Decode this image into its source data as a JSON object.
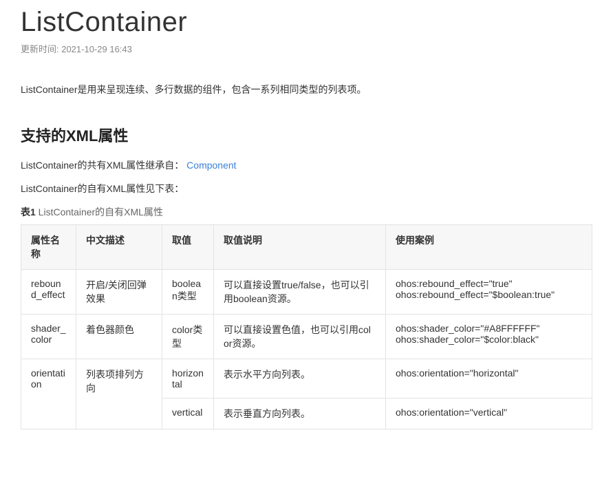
{
  "title": "ListContainer",
  "update_label": "更新时间: 2021-10-29 16:43",
  "intro": "ListContainer是用来呈现连续、多行数据的组件，包含一系列相同类型的列表项。",
  "section_title": "支持的XML属性",
  "inherit_prefix": "ListContainer的共有XML属性继承自：",
  "inherit_link": "Component",
  "own_attrs_text": "ListContainer的自有XML属性见下表：",
  "caption_bold": "表1",
  "caption_rest": " ListContainer的自有XML属性",
  "headers": {
    "h1": "属性名称",
    "h2": "中文描述",
    "h3": "取值",
    "h4": "取值说明",
    "h5": "使用案例"
  },
  "rows": {
    "r1": {
      "name": "rebound_effect",
      "desc": "开启/关闭回弹效果",
      "value": "boolean类型",
      "note": "可以直接设置true/false，也可以引用boolean资源。",
      "example": "ohos:rebound_effect=\"true\"\nohos:rebound_effect=\"$boolean:true\""
    },
    "r2": {
      "name": "shader_color",
      "desc": "着色器颜色",
      "value": "color类型",
      "note": "可以直接设置色值，也可以引用color资源。",
      "example": "ohos:shader_color=\"#A8FFFFFF\"\nohos:shader_color=\"$color:black\""
    },
    "r3a": {
      "value": "horizontal",
      "note": "表示水平方向列表。",
      "example": "ohos:orientation=\"horizontal\""
    },
    "r3": {
      "name": "orientation",
      "desc": "列表项排列方向"
    },
    "r3b": {
      "value": "vertical",
      "note": "表示垂直方向列表。",
      "example": "ohos:orientation=\"vertical\""
    }
  }
}
